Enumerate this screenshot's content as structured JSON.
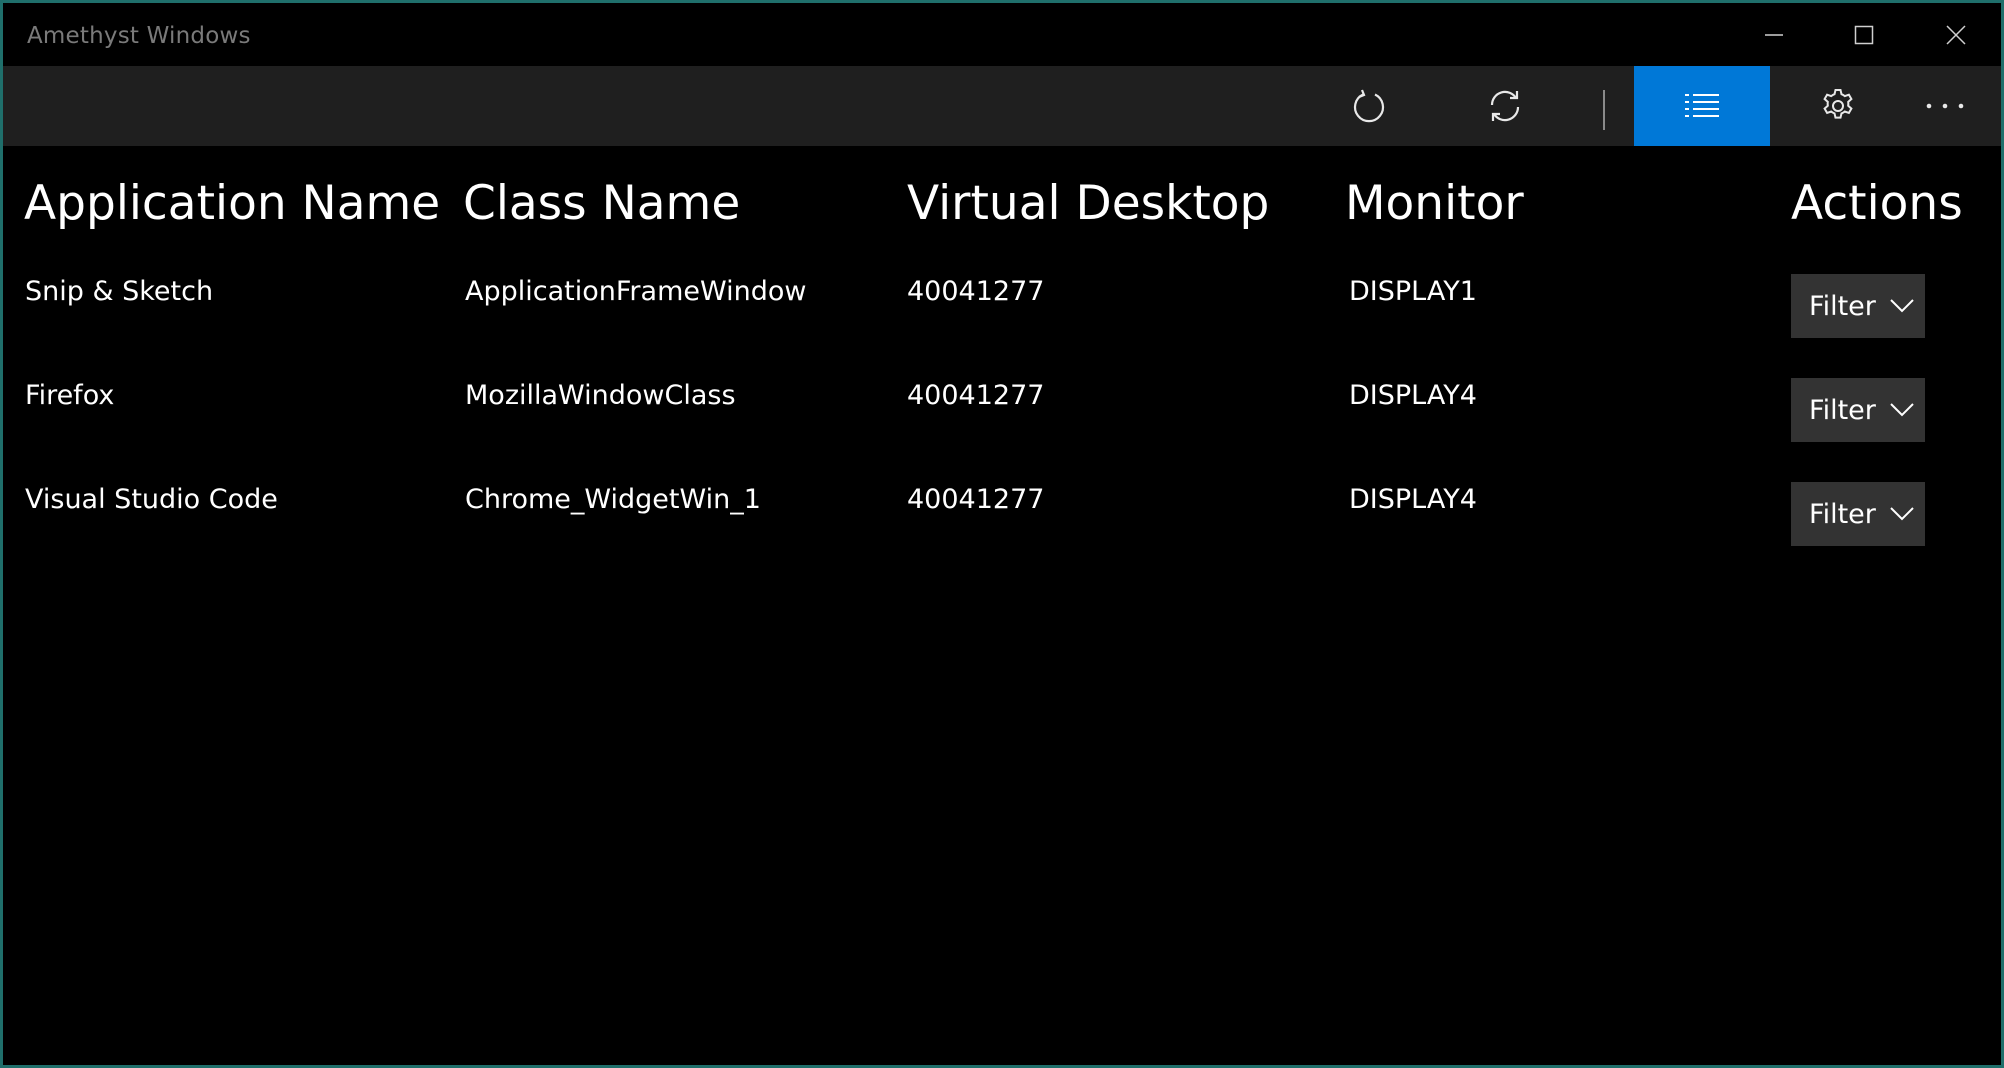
{
  "window": {
    "title": "Amethyst Windows",
    "accent_color": "#0078d7",
    "border_color": "#1f6f6b"
  },
  "caption_buttons": {
    "minimize_icon": "minimize-icon",
    "maximize_icon": "maximize-icon",
    "close_icon": "close-icon"
  },
  "toolbar": {
    "items": [
      {
        "icon": "refresh-icon",
        "active": false
      },
      {
        "icon": "sync-icon",
        "active": false
      },
      {
        "icon": "list-icon",
        "active": true
      },
      {
        "icon": "gear-icon",
        "active": false
      },
      {
        "icon": "more-icon",
        "active": false
      }
    ]
  },
  "table": {
    "columns": [
      "Application Name",
      "Class Name",
      "Virtual Desktop",
      "Monitor",
      "Actions"
    ],
    "rows": [
      {
        "app": "Snip & Sketch",
        "class": "ApplicationFrameWindow",
        "desktop": "40041277",
        "monitor": "DISPLAY1",
        "action": "Filter"
      },
      {
        "app": "Firefox",
        "class": "MozillaWindowClass",
        "desktop": "40041277",
        "monitor": "DISPLAY4",
        "action": "Filter"
      },
      {
        "app": "Visual Studio Code",
        "class": "Chrome_WidgetWin_1",
        "desktop": "40041277",
        "monitor": "DISPLAY4",
        "action": "Filter"
      }
    ]
  }
}
